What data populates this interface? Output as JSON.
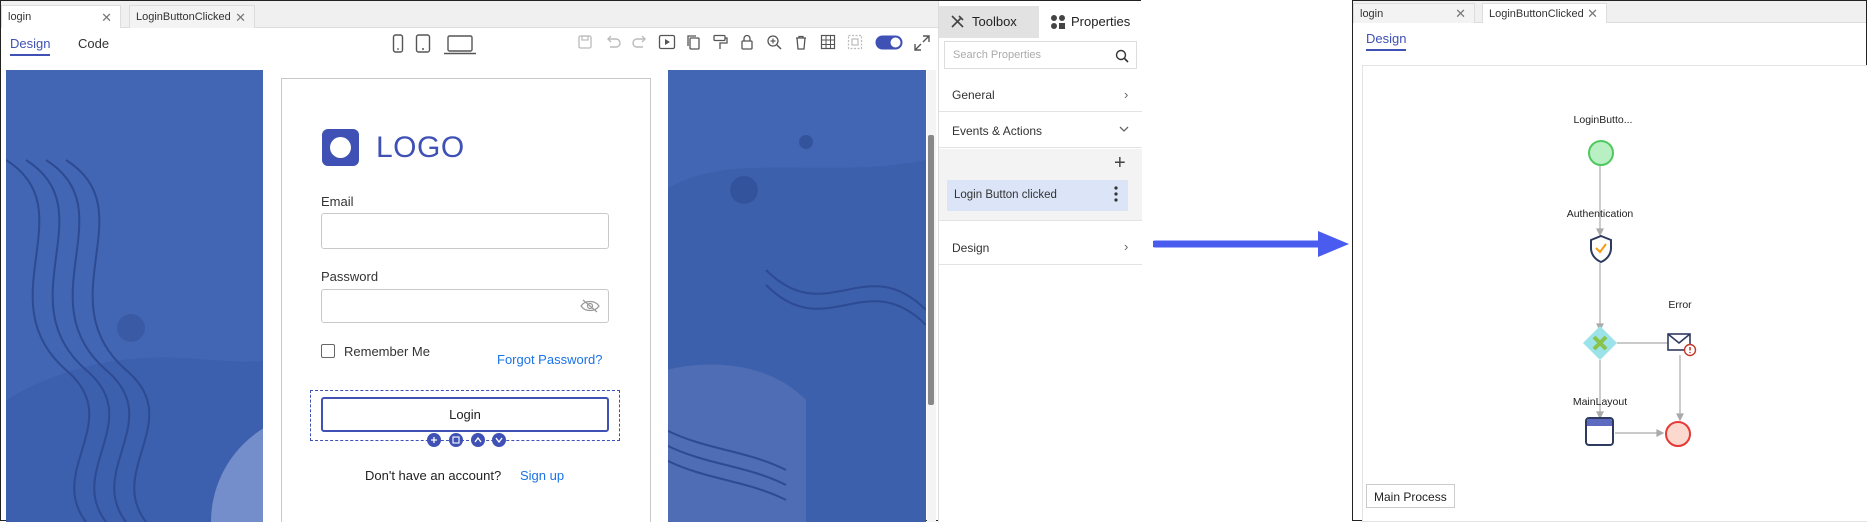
{
  "editor": {
    "tabs": [
      {
        "label": "login"
      },
      {
        "label": "LoginButtonClicked"
      }
    ],
    "subtabs": {
      "design": "Design",
      "code": "Code"
    }
  },
  "canvas": {
    "logo_text": "LOGO",
    "email_label": "Email",
    "password_label": "Password",
    "remember_me": "Remember Me",
    "forgot_password": "Forgot Password?",
    "login_button": "Login",
    "no_account": "Don't have an account?",
    "sign_up": "Sign up",
    "colors": {
      "background": "#4266b4",
      "accent": "#3f51b5"
    }
  },
  "side_panel": {
    "toolbox_tab": "Toolbox",
    "properties_tab": "Properties",
    "search_placeholder": "Search Properties",
    "sections": {
      "general": "General",
      "events": "Events & Actions",
      "design": "Design"
    },
    "event_item": "Login Button clicked"
  },
  "flow": {
    "tabs": [
      {
        "label": "login"
      },
      {
        "label": "LoginButtonClicked"
      }
    ],
    "subtab": "Design",
    "nodes": {
      "start": "LoginButto...",
      "auth": "Authentication",
      "error": "Error",
      "main_layout": "MainLayout"
    },
    "process_label": "Main Process"
  },
  "arrow_color": "#4a5cf0"
}
